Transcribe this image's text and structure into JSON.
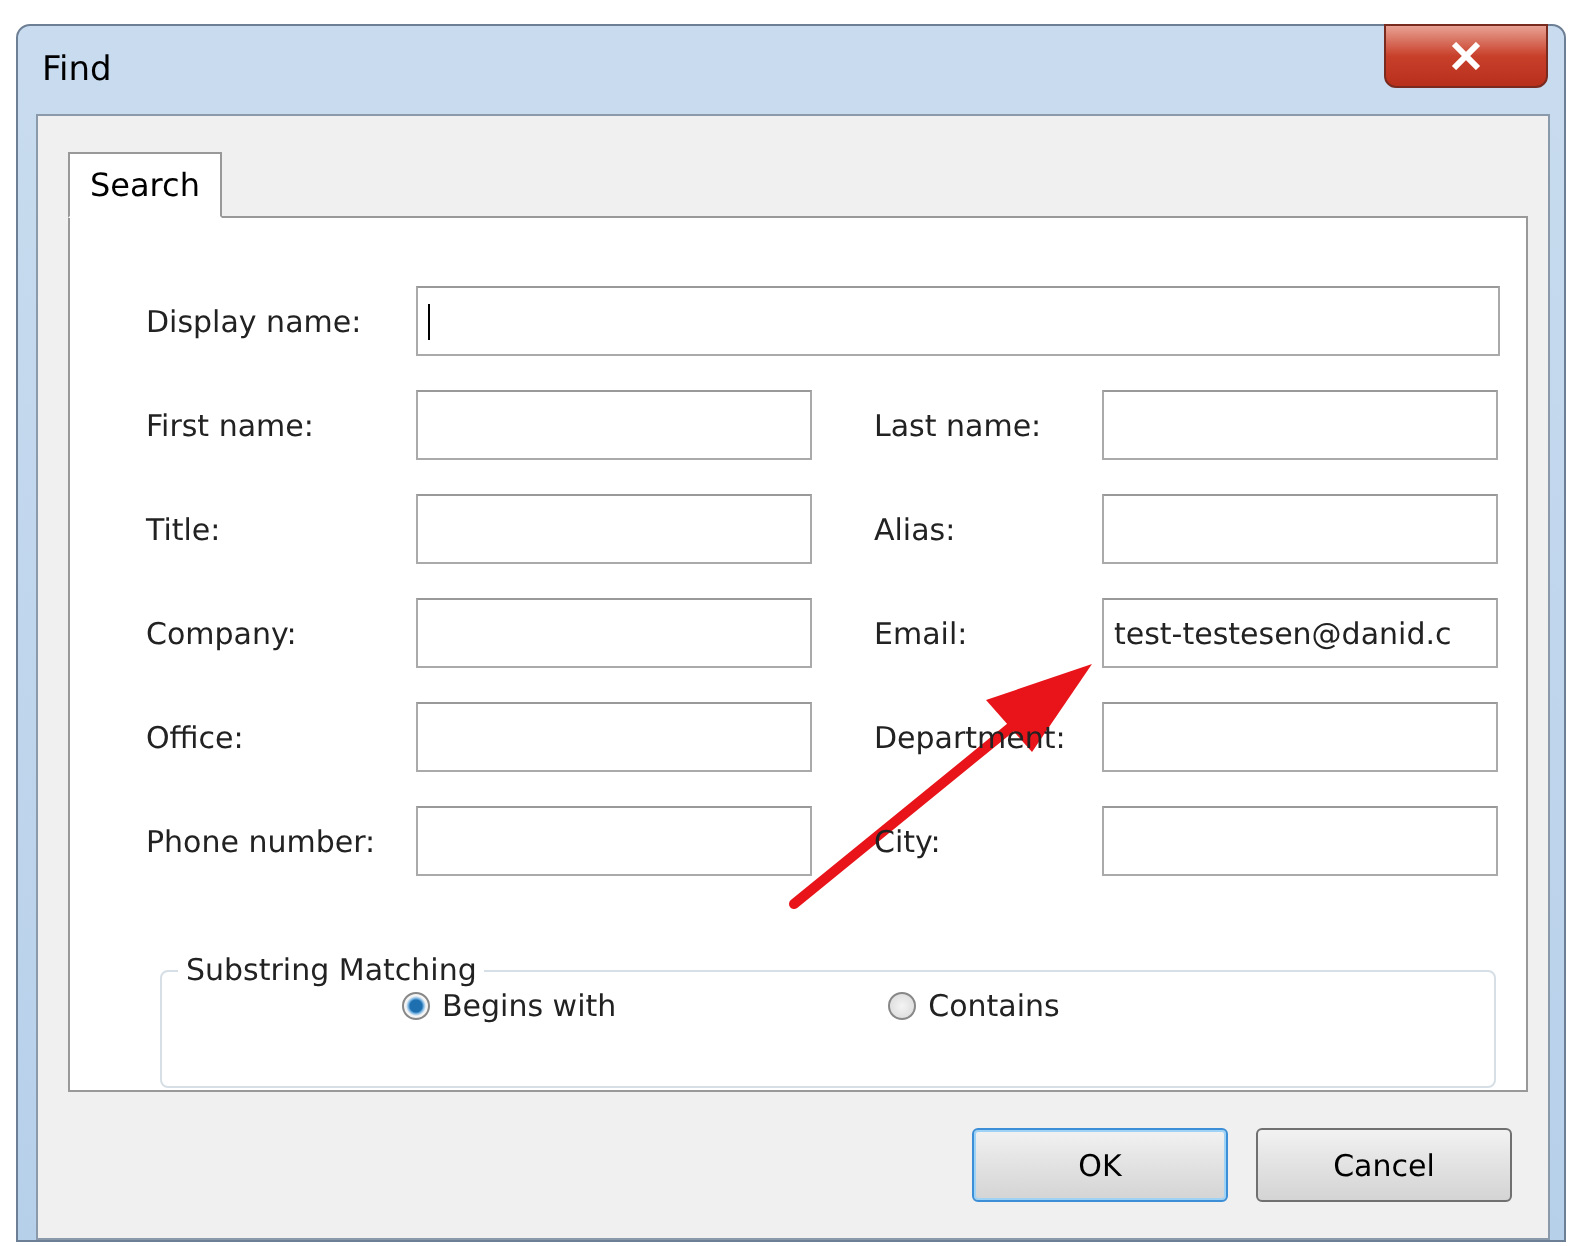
{
  "window": {
    "title": "Find"
  },
  "tabs": [
    {
      "label": "Search",
      "selected": true
    }
  ],
  "rows": [
    {
      "fields": [
        {
          "label": "Display name:",
          "focused": true
        }
      ]
    },
    {
      "fields": [
        {
          "label": "First name:",
          "focused": false
        },
        {
          "label": "Last name:",
          "focused": false
        }
      ]
    },
    {
      "fields": [
        {
          "label": "Title:",
          "focused": false
        },
        {
          "label": "Alias:",
          "focused": false
        }
      ]
    },
    {
      "fields": [
        {
          "label": "Company:",
          "focused": false
        },
        {
          "label": "Email:",
          "value": "test-testesen@danid.c",
          "focused": false
        }
      ]
    },
    {
      "fields": [
        {
          "label": "Office:",
          "focused": false
        },
        {
          "label": "Department:",
          "focused": false
        }
      ]
    },
    {
      "fields": [
        {
          "label": "Phone number:",
          "focused": false
        },
        {
          "label": "City:",
          "focused": false
        }
      ]
    }
  ],
  "matching": {
    "title": "Substring Matching",
    "options": [
      {
        "label": "Begins with",
        "selected": true
      },
      {
        "label": "Contains",
        "selected": false
      }
    ]
  },
  "buttons": [
    {
      "label": "OK",
      "default": true
    },
    {
      "label": "Cancel",
      "default": false
    }
  ],
  "annotation": {
    "kind": "arrow"
  }
}
